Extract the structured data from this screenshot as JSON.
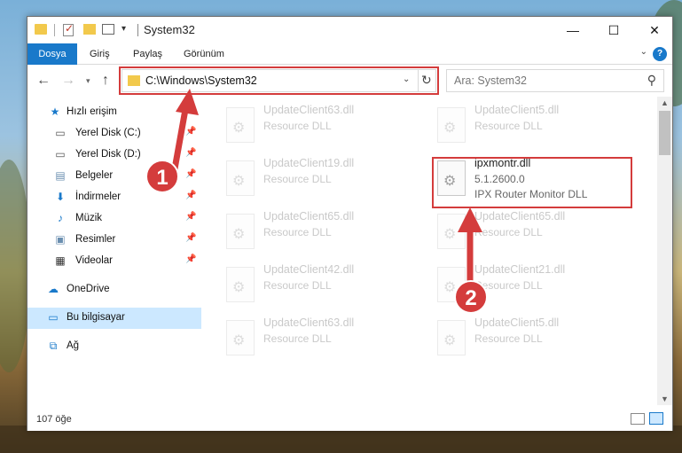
{
  "window": {
    "title": "System32"
  },
  "controls": {
    "minimize": "—",
    "maximize": "☐",
    "close": "✕"
  },
  "ribbon": {
    "tabs": [
      {
        "label": "Dosya"
      },
      {
        "label": "Giriş"
      },
      {
        "label": "Paylaş"
      },
      {
        "label": "Görünüm"
      }
    ],
    "help": "?"
  },
  "address": {
    "path": "C:\\Windows\\System32"
  },
  "search": {
    "placeholder": "Ara: System32"
  },
  "sidebar": {
    "items": [
      {
        "label": "Hızlı erişim",
        "icon": "star-icon",
        "pinned": false
      },
      {
        "label": "Yerel Disk (C:)",
        "icon": "drive-icon",
        "pinned": true
      },
      {
        "label": "Yerel Disk (D:)",
        "icon": "drive-icon",
        "pinned": true
      },
      {
        "label": "Belgeler",
        "icon": "documents-icon",
        "pinned": true
      },
      {
        "label": "İndirmeler",
        "icon": "download-icon",
        "pinned": true
      },
      {
        "label": "Müzik",
        "icon": "music-icon",
        "pinned": true
      },
      {
        "label": "Resimler",
        "icon": "pictures-icon",
        "pinned": true
      },
      {
        "label": "Videolar",
        "icon": "video-icon",
        "pinned": true
      },
      {
        "label": "OneDrive",
        "icon": "cloud-icon",
        "pinned": false
      },
      {
        "label": "Bu bilgisayar",
        "icon": "computer-icon",
        "pinned": false,
        "selected": true
      },
      {
        "label": "Ağ",
        "icon": "network-icon",
        "pinned": false
      }
    ]
  },
  "files": [
    {
      "name": "UpdateClient63.dll",
      "desc": "Resource DLL",
      "faded": true
    },
    {
      "name": "UpdateClient5.dll",
      "desc": "Resource DLL",
      "faded": true
    },
    {
      "name": "UpdateClient19.dll",
      "desc": "Resource DLL",
      "faded": true
    },
    {
      "name": "ipxmontr.dll",
      "version": "5.1.2600.0",
      "desc": "IPX Router Monitor DLL",
      "faded": false
    },
    {
      "name": "UpdateClient65.dll",
      "desc": "Resource DLL",
      "faded": true
    },
    {
      "name": "UpdateClient65.dll",
      "desc": "Resource DLL",
      "faded": true
    },
    {
      "name": "UpdateClient42.dll",
      "desc": "Resource DLL",
      "faded": true
    },
    {
      "name": "UpdateClient21.dll",
      "desc": "Resource DLL",
      "faded": true
    },
    {
      "name": "UpdateClient63.dll",
      "desc": "Resource DLL",
      "faded": true
    },
    {
      "name": "UpdateClient5.dll",
      "desc": "Resource DLL",
      "faded": true
    }
  ],
  "status": {
    "count": "107 öğe"
  },
  "annotations": {
    "step1": "1",
    "step2": "2",
    "color": "#d43c3c"
  }
}
